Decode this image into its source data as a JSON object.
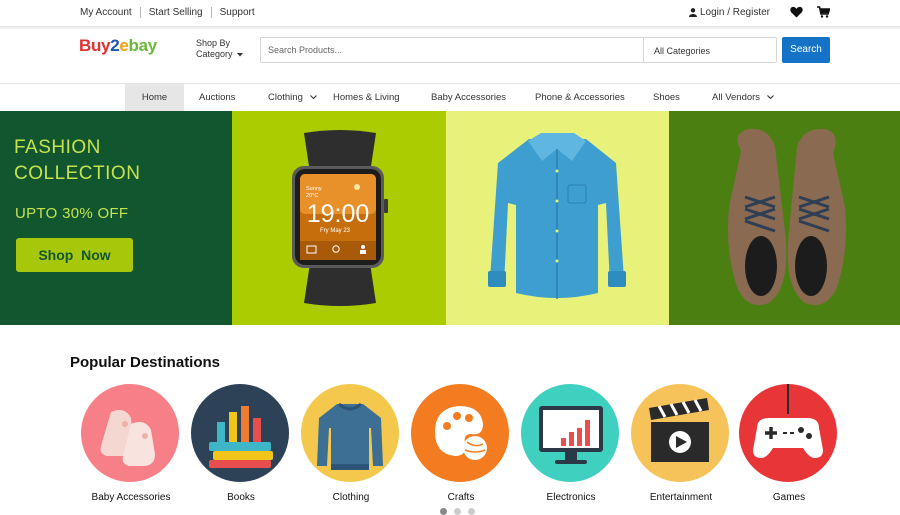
{
  "topbar": {
    "links": [
      "My Account",
      "Start Selling",
      "Support"
    ],
    "login": "Login / Register",
    "icons": [
      "user-icon",
      "heart-icon",
      "cart-icon"
    ]
  },
  "header": {
    "logo": {
      "part1": "Buy",
      "part2": "2",
      "part3": "e",
      "part4": "bay"
    },
    "shop_by_line1": "Shop By",
    "shop_by_line2": "Category",
    "search_placeholder": "Search Products...",
    "category_select": "All Categories",
    "search_button": "Search"
  },
  "nav": {
    "items": [
      "Home",
      "Auctions",
      "Clothing",
      "Homes & Living",
      "Baby Accessories",
      "Phone & Accessories",
      "Shoes",
      "All Vendors"
    ]
  },
  "banner": {
    "title_line1": "FASHION",
    "title_line2": "COLLECTION",
    "offer": "UPTO 30% OFF",
    "cta": "Shop  Now",
    "watch": {
      "time": "19:00",
      "city": "Sunny",
      "temp": "20°C",
      "date": "Fry May 23"
    }
  },
  "popular": {
    "title": "Popular Destinations",
    "items": [
      "Baby Accessories",
      "Books",
      "Clothing",
      "Crafts",
      "Electronics",
      "Entertainment",
      "Games"
    ]
  },
  "colors": {
    "brand_blue": "#1473c6",
    "banner_dark_green": "#11562e",
    "banner_lime": "#abcd00",
    "banner_yellow": "#e8f17a",
    "banner_olive": "#4b7f12",
    "accent_green": "#c6e34f"
  }
}
